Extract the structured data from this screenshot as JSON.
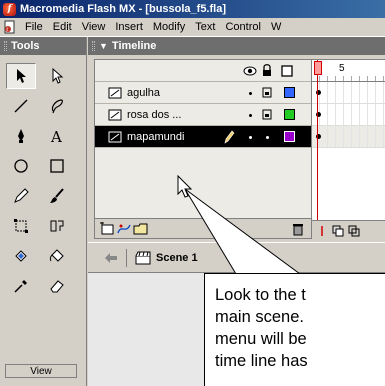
{
  "window": {
    "title": "Macromedia Flash MX - [bussola_f5.fla]"
  },
  "menu": {
    "items": [
      "File",
      "Edit",
      "View",
      "Insert",
      "Modify",
      "Text",
      "Control",
      "W"
    ]
  },
  "tools_panel": {
    "title": "Tools",
    "tools": [
      {
        "name": "arrow-tool",
        "icon": "arrow-icon"
      },
      {
        "name": "subselect-tool",
        "icon": "subselect-icon"
      },
      {
        "name": "line-tool",
        "icon": "line-icon"
      },
      {
        "name": "lasso-tool",
        "icon": "lasso-icon"
      },
      {
        "name": "pen-tool",
        "icon": "pen-icon"
      },
      {
        "name": "text-tool",
        "icon": "text-icon"
      },
      {
        "name": "oval-tool",
        "icon": "oval-icon"
      },
      {
        "name": "rectangle-tool",
        "icon": "rectangle-icon"
      },
      {
        "name": "pencil-tool",
        "icon": "pencil-icon"
      },
      {
        "name": "brush-tool",
        "icon": "brush-icon"
      },
      {
        "name": "free-transform-tool",
        "icon": "free-transform-icon"
      },
      {
        "name": "fill-transform-tool",
        "icon": "fill-transform-icon"
      },
      {
        "name": "ink-bottle-tool",
        "icon": "ink-bottle-icon"
      },
      {
        "name": "paint-bucket-tool",
        "icon": "paint-bucket-icon"
      },
      {
        "name": "eyedropper-tool",
        "icon": "eyedropper-icon"
      },
      {
        "name": "eraser-tool",
        "icon": "eraser-icon"
      }
    ],
    "view_label": "View"
  },
  "timeline": {
    "title": "Timeline",
    "frame_number": "5",
    "layers": [
      {
        "name": "agulha",
        "color": "#3366ff",
        "selected": false
      },
      {
        "name": "rosa dos ...",
        "color": "#22cc22",
        "selected": false
      },
      {
        "name": "mapamundi",
        "color": "#9900cc",
        "selected": true
      }
    ]
  },
  "scene": {
    "label": "Scene 1"
  },
  "callout": {
    "lines": [
      "Look to the t",
      "main scene.",
      "menu will be",
      "time line has"
    ]
  }
}
